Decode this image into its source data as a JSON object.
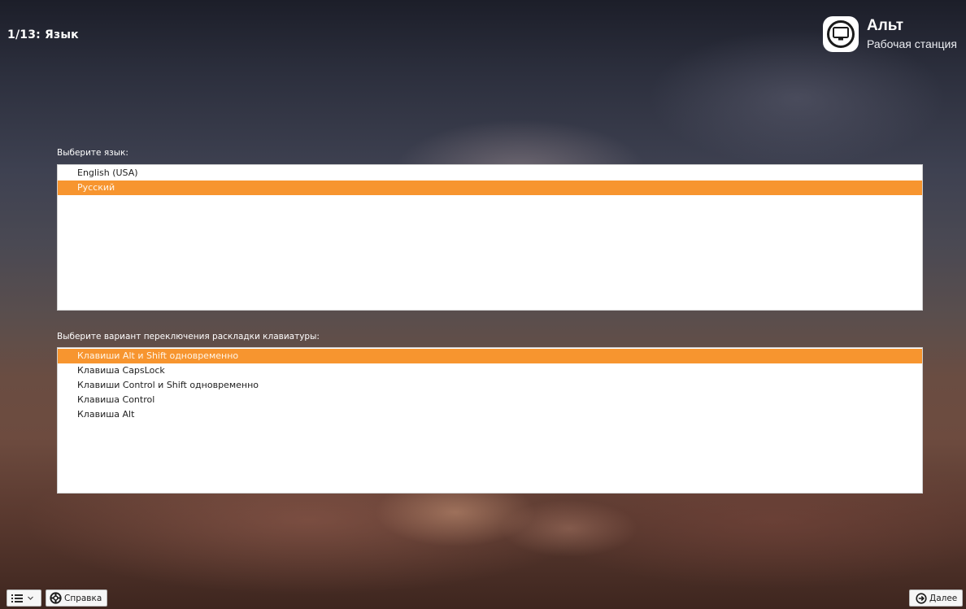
{
  "header": {
    "step_title": "1/13: Язык"
  },
  "logo": {
    "name": "Альт",
    "subtitle": "Рабочая станция",
    "icon": "monitor-icon"
  },
  "language": {
    "label": "Выберите язык:",
    "items": [
      {
        "label": "English (USA)",
        "selected": false
      },
      {
        "label": "Русский",
        "selected": true
      }
    ]
  },
  "keyboard": {
    "label": "Выберите вариант переключения раскладки клавиатуры:",
    "items": [
      {
        "label": "Клавиши Alt и Shift одновременно",
        "selected": true
      },
      {
        "label": "Клавиша CapsLock",
        "selected": false
      },
      {
        "label": "Клавиши Control и Shift одновременно",
        "selected": false
      },
      {
        "label": "Клавиша Control",
        "selected": false
      },
      {
        "label": "Клавиша Alt",
        "selected": false
      }
    ]
  },
  "footer": {
    "menu_icon": "list-icon",
    "dropdown_icon": "chevron-down-icon",
    "help_label": "Справка",
    "help_icon": "lifebuoy-icon",
    "next_label": "Далее",
    "next_icon": "arrow-right-circle-icon"
  },
  "colors": {
    "selection": "#f7952f",
    "list_background": "#ffffff"
  }
}
